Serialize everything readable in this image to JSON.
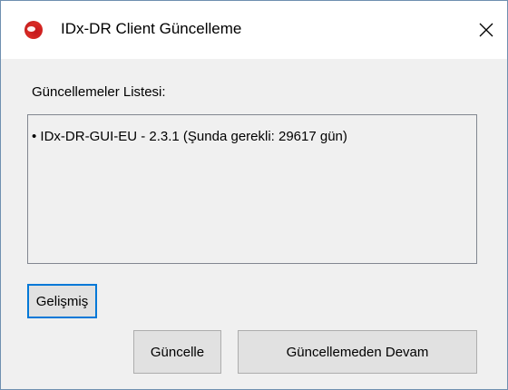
{
  "window": {
    "title": "IDx-DR Client Güncelleme",
    "app_icon": "idx-dr-logo-icon",
    "close_icon": "close-icon"
  },
  "updates": {
    "label": "Güncellemeler Listesi:",
    "items": [
      "• IDx-DR-GUI-EU - 2.3.1 (Şunda gerekli: 29617 gün)"
    ]
  },
  "buttons": {
    "advanced": "Gelişmiş",
    "update": "Güncelle",
    "continue_without_update": "Güncellemeden Devam"
  },
  "colors": {
    "focus_border": "#0078d7",
    "window_bg": "#f0f0f0",
    "titlebar_bg": "#ffffff",
    "icon_red": "#d92a24"
  }
}
